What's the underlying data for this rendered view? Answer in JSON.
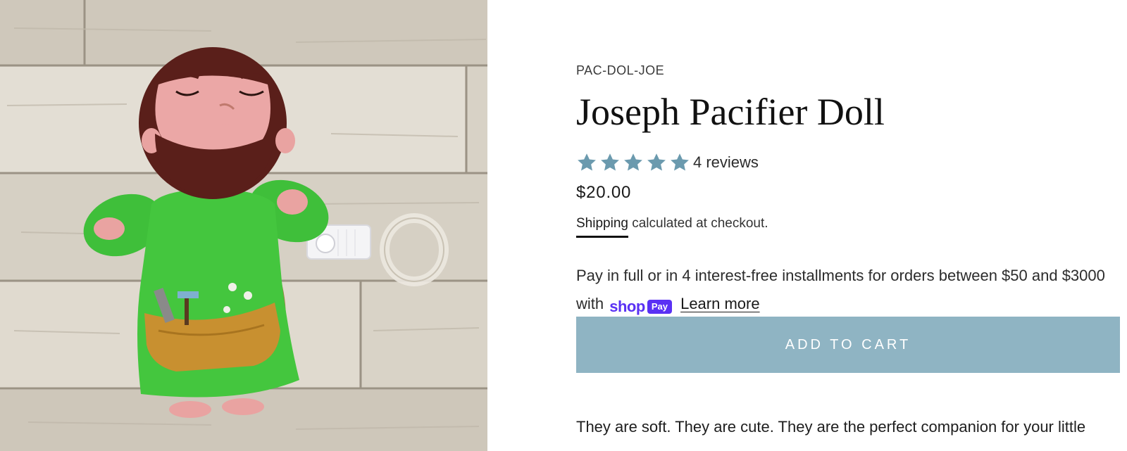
{
  "product": {
    "sku": "PAC-DOL-JOE",
    "title": "Joseph Pacifier Doll",
    "rating": {
      "stars": 5,
      "max": 5,
      "star_color": "#6b9aae",
      "reviews_label": "4 reviews"
    },
    "price": "$20.00",
    "shipping": {
      "link_label": "Shipping",
      "rest": " calculated at checkout."
    },
    "installments": {
      "text_before": "Pay in full or in 4 interest-free installments for orders between $50 and $3000 with",
      "shop_word": "shop",
      "pay_word": "Pay",
      "learn_more": "Learn more",
      "brand_color": "#5a31f4"
    },
    "add_to_cart_label": "ADD TO CART",
    "add_to_cart_color": "#8fb4c3",
    "description": "They are soft. They are cute. They are the perfect companion for your little"
  },
  "image": {
    "icon": "plush-doll-photo"
  }
}
